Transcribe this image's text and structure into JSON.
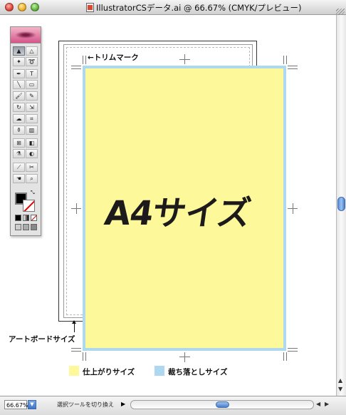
{
  "window": {
    "title": "IllustratorCSデータ.ai @ 66.67% (CMYK/プレビュー)"
  },
  "artwork": {
    "big_label": "A4サイズ",
    "trim_mark_label": "←トリムマーク",
    "artboard_label": "アートボードサイズ",
    "legend": [
      {
        "label": "仕上がりサイズ",
        "color": "#fdf89a"
      },
      {
        "label": "裁ち落としサイズ",
        "color": "#aed8ef"
      }
    ]
  },
  "status": {
    "zoom": "66.67%",
    "message": "選択ツールを切り換え"
  },
  "toolbox": {
    "tools": [
      {
        "icon": "selection-arrow",
        "glyph": "▲"
      },
      {
        "icon": "direct-selection-arrow",
        "glyph": "△"
      },
      {
        "icon": "magic-wand",
        "glyph": "✦"
      },
      {
        "icon": "lasso",
        "glyph": "➰"
      },
      {
        "icon": "pen",
        "glyph": "✒"
      },
      {
        "icon": "type",
        "glyph": "T"
      },
      {
        "icon": "line",
        "glyph": "╲"
      },
      {
        "icon": "rectangle",
        "glyph": "▭"
      },
      {
        "icon": "paintbrush",
        "glyph": "🖌"
      },
      {
        "icon": "pencil",
        "glyph": "✎"
      },
      {
        "icon": "rotate",
        "glyph": "↻"
      },
      {
        "icon": "scale",
        "glyph": "⇲"
      },
      {
        "icon": "warp",
        "glyph": "☁"
      },
      {
        "icon": "free-transform",
        "glyph": "⌗"
      },
      {
        "icon": "symbol-sprayer",
        "glyph": "⚱"
      },
      {
        "icon": "column-graph",
        "glyph": "▥"
      },
      {
        "icon": "mesh",
        "glyph": "⊞"
      },
      {
        "icon": "gradient",
        "glyph": "◧"
      },
      {
        "icon": "eyedropper",
        "glyph": "⚗"
      },
      {
        "icon": "blend",
        "glyph": "◐"
      },
      {
        "icon": "slice",
        "glyph": "⟋"
      },
      {
        "icon": "scissors",
        "glyph": "✂"
      },
      {
        "icon": "hand",
        "glyph": "☚"
      },
      {
        "icon": "zoom",
        "glyph": "⌕"
      }
    ]
  }
}
